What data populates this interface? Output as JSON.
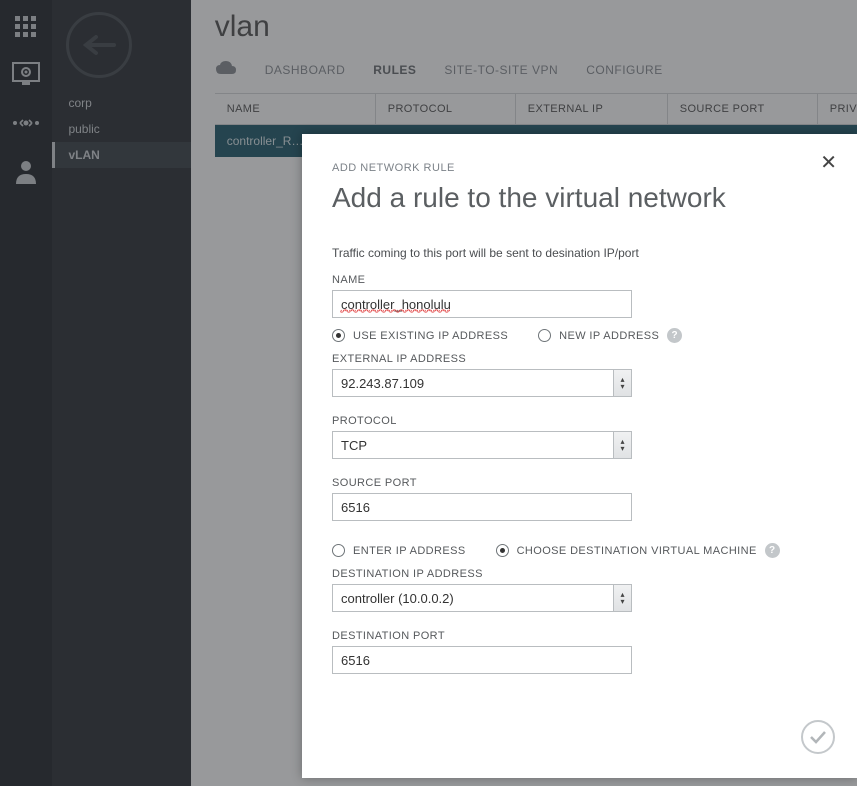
{
  "page": {
    "title": "vlan"
  },
  "sidebar": {
    "items": [
      {
        "label": "corp"
      },
      {
        "label": "public"
      },
      {
        "label": "vLAN"
      }
    ]
  },
  "tabs": {
    "dashboard": "DASHBOARD",
    "rules": "RULES",
    "s2s": "SITE-TO-SITE VPN",
    "configure": "CONFIGURE"
  },
  "table": {
    "headers": {
      "name": "NAME",
      "protocol": "PROTOCOL",
      "external_ip": "EXTERNAL IP",
      "source_port": "SOURCE PORT",
      "private": "PRIV"
    },
    "selected_row_name": "controller_R…"
  },
  "modal": {
    "eyebrow": "ADD NETWORK RULE",
    "title": "Add a rule to the virtual network",
    "description": "Traffic coming to this port will be sent to desination IP/port",
    "labels": {
      "name": "NAME",
      "use_existing": "USE EXISTING IP ADDRESS",
      "new_ip": "NEW IP ADDRESS",
      "external_ip": "EXTERNAL IP ADDRESS",
      "protocol": "PROTOCOL",
      "source_port": "SOURCE PORT",
      "enter_ip": "ENTER IP ADDRESS",
      "choose_vm": "CHOOSE DESTINATION VIRTUAL MACHINE",
      "dest_ip": "DESTINATION IP ADDRESS",
      "dest_port": "DESTINATION PORT"
    },
    "values": {
      "name": "controller_honolulu",
      "external_ip": "92.243.87.109",
      "protocol": "TCP",
      "source_port": "6516",
      "destination_ip": "controller (10.0.0.2)",
      "destination_port": "6516"
    },
    "radios": {
      "ip_mode": "existing",
      "dest_mode": "choose_vm"
    }
  }
}
